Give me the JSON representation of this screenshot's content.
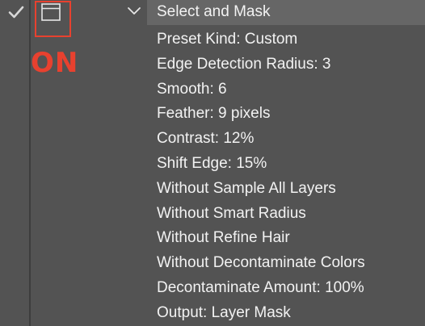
{
  "step": {
    "enabled_icon": "checkmark-icon",
    "dialog_toggle_icon": "dialog-toggle-icon",
    "expand_icon": "chevron-down-icon",
    "title": "Select and Mask"
  },
  "annotation": {
    "label": "ON",
    "color": "#e8412f"
  },
  "parameters": [
    "Preset Kind: Custom",
    "Edge Detection Radius: 3",
    "Smooth: 6",
    "Feather: 9 pixels",
    "Contrast: 12%",
    "Shift Edge: 15%",
    "Without Sample All Layers",
    "Without Smart Radius",
    "Without Refine Hair",
    "Without Decontaminate Colors",
    "Decontaminate Amount: 100%",
    "Output: Layer Mask"
  ]
}
